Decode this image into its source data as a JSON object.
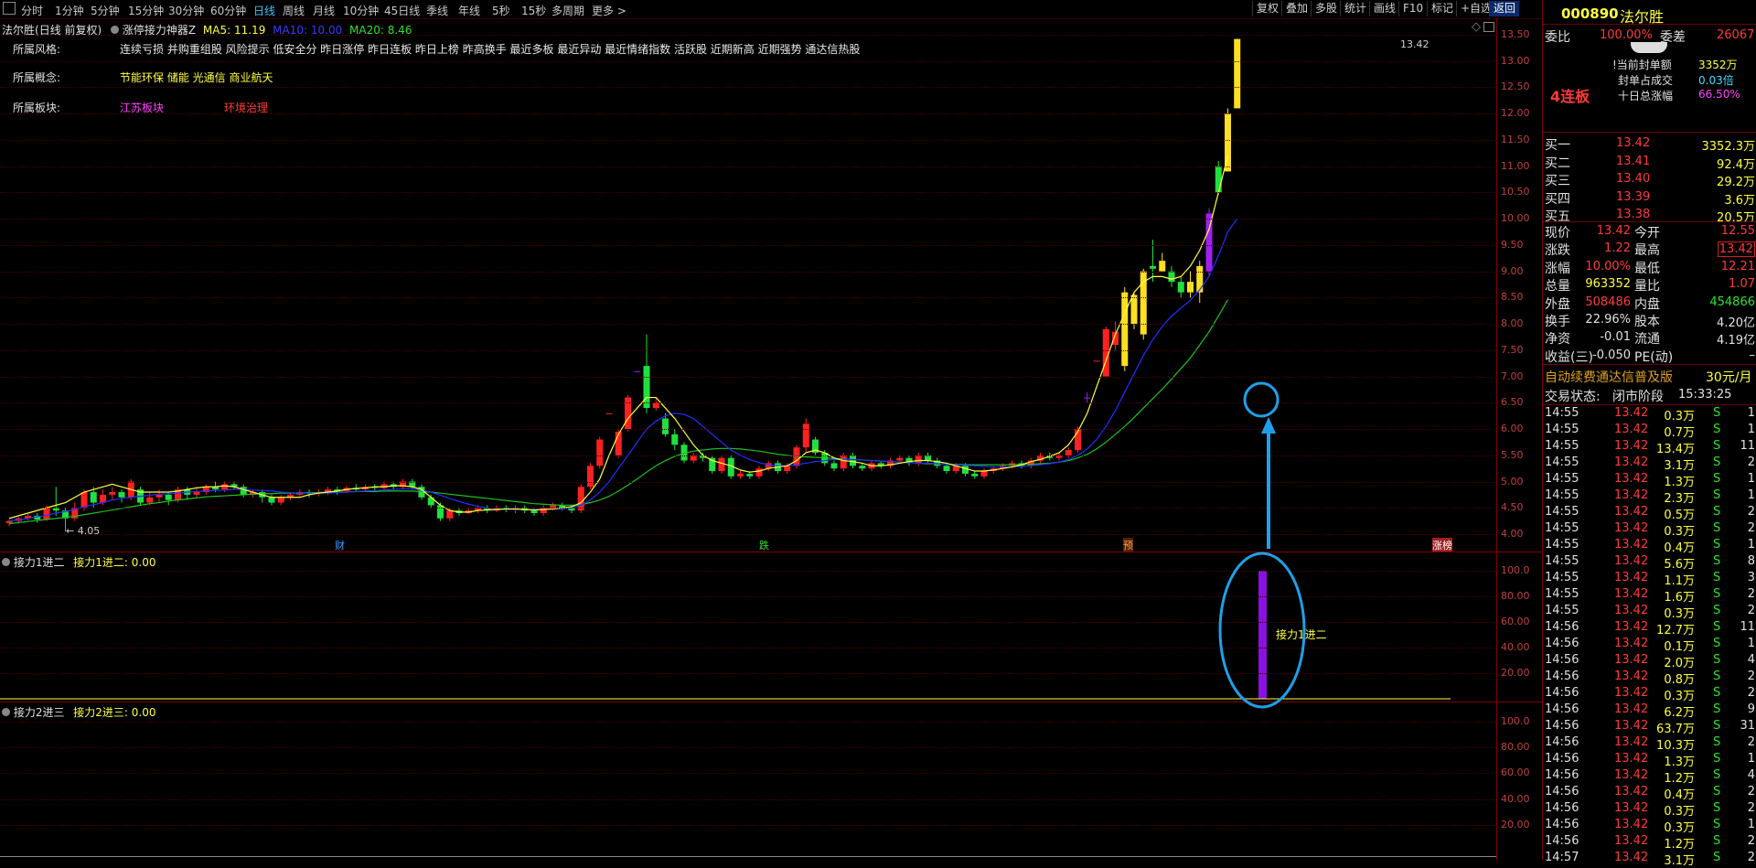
{
  "top_tabs": [
    "分时",
    "1分钟",
    "5分钟",
    "15分钟",
    "30分钟",
    "60分钟",
    "日线",
    "周线",
    "月线",
    "10分钟",
    "45日线",
    "季线",
    "年线",
    "5秒",
    "15秒",
    "多周期",
    "更多 >"
  ],
  "right_buttons": [
    "复权",
    "叠加",
    "多股",
    "统计",
    "画线",
    "F10",
    "标记",
    "+自选",
    "返回"
  ],
  "chart_header": {
    "stock": "法尔胜",
    "period": "(日线 前复权)",
    "indicator": "涨停接力神器Z",
    "ma5": "MA5: 11.19",
    "ma10": "MA10: 10.00",
    "ma20": "MA20: 8.46"
  },
  "info": {
    "style_label": "所属风格:",
    "style_value": "连续亏损 并购重组股 风险提示 低安全分 昨日涨停 昨日连板 昨日上榜 昨高换手 最近多板 最近异动 最近情绪指数 活跃股 近期新高 近期强势 通达信热股",
    "concept_label": "所属概念:",
    "concept_value": "节能环保 储能 光通信 商业航天",
    "sector_label": "所属板块:",
    "sector_1": "江苏板块",
    "sector_2": "环境治理"
  },
  "price_axis": [
    "13.50",
    "13.00",
    "12.50",
    "12.00",
    "11.50",
    "11.00",
    "10.50",
    "10.00",
    "9.50",
    "9.00",
    "8.50",
    "8.00",
    "7.50",
    "7.00",
    "6.50",
    "6.00",
    "5.50",
    "5.00",
    "4.50",
    "4.00"
  ],
  "chart_labels": {
    "high": "13.42",
    "low": "← 4.05",
    "event1": "财",
    "event2": "跌",
    "event3": "预",
    "event4": "涨榜"
  },
  "panel1": {
    "title": "接力1进二",
    "value": "接力1进二: 0.00",
    "signal": "接力1进二",
    "axis": [
      "100.0",
      "80.00",
      "60.00",
      "40.00",
      "20.00"
    ]
  },
  "panel2": {
    "title": "接力2进三",
    "value": "接力2进三: 0.00",
    "axis": [
      "100.0",
      "80.00",
      "60.00",
      "40.00",
      "20.00"
    ]
  },
  "chart_data": {
    "type": "candlestick",
    "ylim": [
      4.0,
      13.5
    ],
    "candles": [
      [
        4.21,
        4.25,
        4.15,
        4.28
      ],
      [
        4.25,
        4.3,
        4.2,
        4.33
      ],
      [
        4.3,
        4.35,
        4.26,
        4.38
      ],
      [
        4.35,
        4.28,
        4.22,
        4.4
      ],
      [
        4.28,
        4.5,
        4.25,
        4.55
      ],
      [
        4.5,
        4.45,
        4.35,
        4.9
      ],
      [
        4.45,
        4.3,
        4.05,
        4.5
      ],
      [
        4.3,
        4.5,
        4.25,
        4.6
      ],
      [
        4.5,
        4.8,
        4.45,
        4.85
      ],
      [
        4.8,
        4.6,
        4.5,
        4.9
      ],
      [
        4.6,
        4.75,
        4.55,
        4.85
      ],
      [
        4.75,
        4.8,
        4.65,
        4.9
      ],
      [
        4.8,
        4.7,
        4.6,
        4.85
      ],
      [
        4.7,
        5.0,
        4.65,
        5.05
      ],
      [
        4.85,
        4.6,
        4.55,
        4.9
      ],
      [
        4.6,
        4.7,
        4.55,
        4.8
      ],
      [
        4.7,
        4.75,
        4.6,
        4.85
      ],
      [
        4.75,
        4.65,
        4.55,
        4.8
      ],
      [
        4.65,
        4.85,
        4.6,
        4.9
      ],
      [
        4.85,
        4.75,
        4.65,
        4.9
      ],
      [
        4.75,
        4.8,
        4.7,
        4.9
      ],
      [
        4.8,
        4.9,
        4.75,
        4.95
      ],
      [
        4.9,
        4.85,
        4.8,
        5.0
      ],
      [
        4.85,
        4.95,
        4.8,
        5.0
      ],
      [
        4.95,
        4.9,
        4.85,
        5.0
      ],
      [
        4.9,
        4.75,
        4.7,
        4.95
      ],
      [
        4.75,
        4.8,
        4.7,
        4.85
      ],
      [
        4.8,
        4.7,
        4.6,
        4.85
      ],
      [
        4.7,
        4.6,
        4.55,
        4.75
      ],
      [
        4.6,
        4.7,
        4.55,
        4.75
      ],
      [
        4.7,
        4.75,
        4.65,
        4.8
      ],
      [
        4.75,
        4.8,
        4.7,
        4.85
      ],
      [
        4.8,
        4.78,
        4.7,
        4.85
      ],
      [
        4.78,
        4.8,
        4.72,
        4.85
      ],
      [
        4.8,
        4.85,
        4.75,
        4.9
      ],
      [
        4.85,
        4.82,
        4.75,
        4.9
      ],
      [
        4.82,
        4.88,
        4.78,
        4.92
      ],
      [
        4.88,
        4.85,
        4.8,
        4.95
      ],
      [
        4.85,
        4.9,
        4.8,
        4.95
      ],
      [
        4.9,
        4.88,
        4.82,
        4.95
      ],
      [
        4.88,
        4.95,
        4.85,
        5.0
      ],
      [
        4.95,
        4.9,
        4.85,
        5.0
      ],
      [
        4.9,
        5.0,
        4.85,
        5.05
      ],
      [
        5.0,
        4.9,
        4.85,
        5.05
      ],
      [
        4.9,
        4.7,
        4.65,
        4.95
      ],
      [
        4.7,
        4.55,
        4.5,
        4.75
      ],
      [
        4.55,
        4.3,
        4.25,
        4.6
      ],
      [
        4.3,
        4.45,
        4.25,
        4.5
      ],
      [
        4.45,
        4.4,
        4.35,
        4.5
      ],
      [
        4.4,
        4.45,
        4.38,
        4.5
      ],
      [
        4.45,
        4.5,
        4.4,
        4.55
      ],
      [
        4.5,
        4.45,
        4.4,
        4.55
      ],
      [
        4.45,
        4.5,
        4.42,
        4.55
      ],
      [
        4.5,
        4.48,
        4.42,
        4.55
      ],
      [
        4.48,
        4.5,
        4.4,
        4.55
      ],
      [
        4.5,
        4.45,
        4.4,
        4.55
      ],
      [
        4.45,
        4.4,
        4.35,
        4.5
      ],
      [
        4.4,
        4.5,
        4.35,
        4.55
      ],
      [
        4.5,
        4.55,
        4.45,
        4.6
      ],
      [
        4.55,
        4.5,
        4.45,
        4.6
      ],
      [
        4.5,
        4.45,
        4.4,
        4.55
      ],
      [
        4.45,
        4.9,
        4.4,
        4.95
      ],
      [
        4.9,
        5.3,
        4.85,
        5.35
      ],
      [
        5.3,
        5.8,
        5.25,
        5.85
      ],
      [
        6.3,
        6.3,
        6.3,
        6.3
      ],
      [
        5.5,
        5.95,
        5.45,
        6.0
      ],
      [
        6.0,
        6.6,
        5.95,
        6.65
      ],
      [
        7.1,
        7.1,
        7.1,
        7.1
      ],
      [
        7.2,
        6.4,
        6.3,
        7.8
      ],
      [
        6.4,
        6.5,
        6.35,
        6.6
      ],
      [
        6.2,
        5.9,
        5.85,
        6.3
      ],
      [
        5.9,
        5.7,
        5.6,
        6.0
      ],
      [
        5.7,
        5.4,
        5.35,
        5.75
      ],
      [
        5.4,
        5.5,
        5.35,
        5.55
      ],
      [
        5.5,
        5.45,
        5.38,
        5.55
      ],
      [
        5.45,
        5.2,
        5.15,
        5.5
      ],
      [
        5.2,
        5.45,
        5.15,
        5.5
      ],
      [
        5.45,
        5.1,
        5.05,
        5.5
      ],
      [
        5.1,
        5.15,
        5.05,
        5.2
      ],
      [
        5.15,
        5.1,
        5.05,
        5.2
      ],
      [
        5.1,
        5.25,
        5.05,
        5.3
      ],
      [
        5.25,
        5.35,
        5.2,
        5.4
      ],
      [
        5.35,
        5.2,
        5.15,
        5.4
      ],
      [
        5.2,
        5.3,
        5.15,
        5.35
      ],
      [
        5.3,
        5.65,
        5.25,
        5.7
      ],
      [
        5.65,
        6.1,
        5.55,
        6.2
      ],
      [
        5.8,
        5.55,
        5.5,
        5.85
      ],
      [
        5.55,
        5.35,
        5.3,
        5.6
      ],
      [
        5.35,
        5.25,
        5.2,
        5.4
      ],
      [
        5.25,
        5.5,
        5.2,
        5.55
      ],
      [
        5.5,
        5.3,
        5.25,
        5.55
      ],
      [
        5.3,
        5.25,
        5.2,
        5.35
      ],
      [
        5.25,
        5.35,
        5.2,
        5.4
      ],
      [
        5.35,
        5.3,
        5.25,
        5.4
      ],
      [
        5.3,
        5.4,
        5.25,
        5.45
      ],
      [
        5.4,
        5.45,
        5.35,
        5.5
      ],
      [
        5.45,
        5.35,
        5.3,
        5.5
      ],
      [
        5.35,
        5.5,
        5.3,
        5.55
      ],
      [
        5.5,
        5.4,
        5.35,
        5.55
      ],
      [
        5.4,
        5.3,
        5.25,
        5.45
      ],
      [
        5.3,
        5.2,
        5.15,
        5.35
      ],
      [
        5.2,
        5.3,
        5.15,
        5.35
      ],
      [
        5.3,
        5.15,
        5.1,
        5.35
      ],
      [
        5.15,
        5.1,
        5.05,
        5.2
      ],
      [
        5.1,
        5.2,
        5.05,
        5.25
      ],
      [
        5.2,
        5.25,
        5.15,
        5.3
      ],
      [
        5.25,
        5.3,
        5.2,
        5.35
      ],
      [
        5.3,
        5.35,
        5.25,
        5.4
      ],
      [
        5.35,
        5.3,
        5.25,
        5.4
      ],
      [
        5.3,
        5.4,
        5.25,
        5.45
      ],
      [
        5.4,
        5.5,
        5.35,
        5.55
      ],
      [
        5.5,
        5.45,
        5.4,
        5.55
      ],
      [
        5.45,
        5.5,
        5.4,
        5.55
      ],
      [
        5.5,
        5.6,
        5.45,
        5.65
      ],
      [
        5.6,
        6.0,
        5.55,
        6.05
      ],
      [
        6.6,
        6.6,
        6.5,
        6.7
      ],
      [
        7.3,
        7.3,
        7.3,
        7.3
      ],
      [
        7.0,
        7.9,
        7.0,
        7.95
      ],
      [
        7.6,
        7.85,
        7.5,
        8.05
      ],
      [
        7.2,
        8.6,
        7.1,
        8.7
      ],
      [
        8.0,
        8.55,
        7.9,
        8.6
      ],
      [
        7.8,
        9.0,
        7.7,
        9.05
      ],
      [
        9.1,
        9.05,
        8.8,
        9.6
      ],
      [
        9.0,
        9.2,
        9.0,
        9.35
      ],
      [
        9.0,
        8.8,
        8.7,
        9.1
      ],
      [
        8.8,
        8.6,
        8.5,
        8.9
      ],
      [
        8.6,
        8.8,
        8.5,
        9.0
      ],
      [
        8.6,
        9.1,
        8.4,
        9.2
      ],
      [
        9.0,
        10.1,
        8.9,
        10.2
      ],
      [
        11.0,
        10.5,
        10.45,
        11.1
      ],
      [
        10.9,
        12.0,
        10.9,
        12.1
      ],
      [
        12.1,
        13.42,
        12.1,
        13.42
      ]
    ],
    "ma5": [
      4.3,
      4.35,
      4.4,
      4.45,
      4.5,
      4.55,
      4.6,
      4.7,
      4.8,
      4.85,
      4.9,
      4.95,
      4.9,
      4.85,
      4.8,
      4.8,
      4.8,
      4.8,
      4.82,
      4.85,
      4.88,
      4.9,
      4.9,
      4.92,
      4.9,
      4.85,
      4.8,
      4.75,
      4.7,
      4.7,
      4.7,
      4.7,
      4.75,
      4.78,
      4.8,
      4.82,
      4.85,
      4.87,
      4.88,
      4.9,
      4.9,
      4.92,
      4.92,
      4.9,
      4.85,
      4.7,
      4.55,
      4.45,
      4.42,
      4.42,
      4.45,
      4.46,
      4.47,
      4.48,
      4.48,
      4.47,
      4.46,
      4.47,
      4.48,
      4.5,
      4.52,
      4.6,
      4.8,
      5.05,
      5.5,
      5.9,
      6.2,
      6.4,
      6.6,
      6.6,
      6.4,
      6.2,
      5.95,
      5.7,
      5.5,
      5.4,
      5.35,
      5.3,
      5.22,
      5.18,
      5.2,
      5.25,
      5.28,
      5.3,
      5.4,
      5.55,
      5.6,
      5.55,
      5.45,
      5.4,
      5.38,
      5.35,
      5.3,
      5.3,
      5.32,
      5.35,
      5.38,
      5.4,
      5.4,
      5.38,
      5.35,
      5.3,
      5.25,
      5.2,
      5.2,
      5.22,
      5.25,
      5.28,
      5.32,
      5.38,
      5.42,
      5.48,
      5.55,
      5.7,
      5.95,
      6.3,
      6.8,
      7.3,
      7.8,
      8.2,
      8.6,
      8.8,
      8.9,
      8.9,
      8.85,
      8.9,
      9.1,
      9.4,
      9.8,
      10.5,
      11.2
    ],
    "ma10": [
      4.25,
      4.27,
      4.3,
      4.33,
      4.36,
      4.4,
      4.43,
      4.47,
      4.52,
      4.56,
      4.6,
      4.65,
      4.68,
      4.7,
      4.72,
      4.74,
      4.76,
      4.77,
      4.78,
      4.8,
      4.81,
      4.82,
      4.83,
      4.84,
      4.85,
      4.85,
      4.84,
      4.83,
      4.82,
      4.8,
      4.79,
      4.78,
      4.78,
      4.78,
      4.78,
      4.79,
      4.8,
      4.81,
      4.82,
      4.83,
      4.84,
      4.85,
      4.86,
      4.86,
      4.84,
      4.8,
      4.74,
      4.68,
      4.62,
      4.57,
      4.53,
      4.5,
      4.48,
      4.47,
      4.47,
      4.47,
      4.47,
      4.47,
      4.48,
      4.48,
      4.5,
      4.55,
      4.65,
      4.8,
      5.0,
      5.25,
      5.5,
      5.75,
      6.0,
      6.15,
      6.25,
      6.3,
      6.28,
      6.2,
      6.05,
      5.9,
      5.75,
      5.6,
      5.5,
      5.42,
      5.36,
      5.32,
      5.3,
      5.3,
      5.32,
      5.35,
      5.38,
      5.4,
      5.42,
      5.42,
      5.42,
      5.41,
      5.4,
      5.39,
      5.38,
      5.37,
      5.36,
      5.35,
      5.35,
      5.34,
      5.33,
      5.32,
      5.31,
      5.3,
      5.29,
      5.28,
      5.28,
      5.28,
      5.29,
      5.3,
      5.32,
      5.34,
      5.37,
      5.42,
      5.5,
      5.62,
      5.8,
      6.05,
      6.35,
      6.7,
      7.05,
      7.4,
      7.7,
      7.95,
      8.15,
      8.3,
      8.45,
      8.65,
      8.9,
      9.3,
      9.75,
      10.0
    ],
    "ma20": [
      4.2,
      4.22,
      4.24,
      4.26,
      4.28,
      4.3,
      4.32,
      4.34,
      4.37,
      4.4,
      4.43,
      4.46,
      4.49,
      4.52,
      4.55,
      4.58,
      4.6,
      4.63,
      4.65,
      4.67,
      4.69,
      4.71,
      4.72,
      4.73,
      4.74,
      4.75,
      4.76,
      4.77,
      4.77,
      4.78,
      4.78,
      4.78,
      4.79,
      4.79,
      4.8,
      4.8,
      4.8,
      4.81,
      4.81,
      4.81,
      4.82,
      4.82,
      4.82,
      4.82,
      4.81,
      4.8,
      4.78,
      4.76,
      4.74,
      4.72,
      4.7,
      4.68,
      4.66,
      4.64,
      4.62,
      4.6,
      4.58,
      4.57,
      4.56,
      4.55,
      4.55,
      4.56,
      4.6,
      4.65,
      4.72,
      4.82,
      4.93,
      5.05,
      5.18,
      5.3,
      5.4,
      5.48,
      5.54,
      5.58,
      5.6,
      5.62,
      5.63,
      5.63,
      5.62,
      5.6,
      5.58,
      5.55,
      5.52,
      5.5,
      5.48,
      5.47,
      5.46,
      5.45,
      5.44,
      5.43,
      5.42,
      5.41,
      5.4,
      5.39,
      5.38,
      5.37,
      5.36,
      5.35,
      5.34,
      5.34,
      5.33,
      5.33,
      5.32,
      5.32,
      5.32,
      5.32,
      5.32,
      5.32,
      5.33,
      5.33,
      5.34,
      5.35,
      5.37,
      5.4,
      5.45,
      5.52,
      5.62,
      5.75,
      5.9,
      6.05,
      6.22,
      6.4,
      6.58,
      6.76,
      6.95,
      7.15,
      7.35,
      7.6,
      7.85,
      8.15,
      8.46
    ]
  },
  "sidebar": {
    "code": "000890",
    "name": "法尔胜",
    "weibi_label": "委比",
    "weibi_value": "100.00%",
    "weicha_label": "委差",
    "weicha_value": "26067",
    "streak": "4连板",
    "seal_label": "!当前封单额",
    "seal_value": "3352万",
    "seal_ratio_label": "封单占成交",
    "seal_ratio_value": "0.03倍",
    "tenday_label": "十日总涨幅",
    "tenday_value": "66.50%",
    "bids": [
      {
        "label": "买一",
        "price": "13.42",
        "vol": "3352.3万"
      },
      {
        "label": "买二",
        "price": "13.41",
        "vol": "92.4万"
      },
      {
        "label": "买三",
        "price": "13.40",
        "vol": "29.2万"
      },
      {
        "label": "买四",
        "price": "13.39",
        "vol": "3.6万"
      },
      {
        "label": "买五",
        "price": "13.38",
        "vol": "20.5万"
      }
    ],
    "stats": [
      {
        "l1": "现价",
        "v1": "13.42",
        "l2": "今开",
        "v2": "12.55"
      },
      {
        "l1": "涨跌",
        "v1": "1.22",
        "l2": "最高",
        "v2": "13.42"
      },
      {
        "l1": "涨幅",
        "v1": "10.00%",
        "l2": "最低",
        "v2": "12.21"
      },
      {
        "l1": "总量",
        "v1": "963352",
        "l2": "量比",
        "v2": "1.07"
      },
      {
        "l1": "外盘",
        "v1": "508486",
        "l2": "内盘",
        "v2": "454866"
      },
      {
        "l1": "换手",
        "v1": "22.96%",
        "l2": "股本",
        "v2": "4.20亿"
      },
      {
        "l1": "净资",
        "v1": "-0.01",
        "l2": "流通",
        "v2": "4.19亿"
      },
      {
        "l1": "收益(三)",
        "v1": "-0.050",
        "l2": "PE(动)",
        "v2": "–"
      }
    ],
    "ad": "自动续费通达信普及版",
    "ad_price": "30元/月",
    "status_label": "交易状态:",
    "status_value": "闭市阶段",
    "status_time": "15:33:25",
    "ticks": [
      [
        "14:55",
        "13.42",
        "0.3万",
        "S",
        "1"
      ],
      [
        "14:55",
        "13.42",
        "0.7万",
        "S",
        "1"
      ],
      [
        "14:55",
        "13.42",
        "13.4万",
        "S",
        "11"
      ],
      [
        "14:55",
        "13.42",
        "3.1万",
        "S",
        "2"
      ],
      [
        "14:55",
        "13.42",
        "1.3万",
        "S",
        "1"
      ],
      [
        "14:55",
        "13.42",
        "2.3万",
        "S",
        "1"
      ],
      [
        "14:55",
        "13.42",
        "0.5万",
        "S",
        "2"
      ],
      [
        "14:55",
        "13.42",
        "0.3万",
        "S",
        "2"
      ],
      [
        "14:55",
        "13.42",
        "0.4万",
        "S",
        "1"
      ],
      [
        "14:55",
        "13.42",
        "5.6万",
        "S",
        "8"
      ],
      [
        "14:55",
        "13.42",
        "1.1万",
        "S",
        "3"
      ],
      [
        "14:55",
        "13.42",
        "1.6万",
        "S",
        "2"
      ],
      [
        "14:55",
        "13.42",
        "0.3万",
        "S",
        "2"
      ],
      [
        "14:56",
        "13.42",
        "12.7万",
        "S",
        "11"
      ],
      [
        "14:56",
        "13.42",
        "0.1万",
        "S",
        "1"
      ],
      [
        "14:56",
        "13.42",
        "2.0万",
        "S",
        "4"
      ],
      [
        "14:56",
        "13.42",
        "0.8万",
        "S",
        "2"
      ],
      [
        "14:56",
        "13.42",
        "0.3万",
        "S",
        "2"
      ],
      [
        "14:56",
        "13.42",
        "6.2万",
        "S",
        "9"
      ],
      [
        "14:56",
        "13.42",
        "63.7万",
        "S",
        "31"
      ],
      [
        "14:56",
        "13.42",
        "10.3万",
        "S",
        "2"
      ],
      [
        "14:56",
        "13.42",
        "1.3万",
        "S",
        "1"
      ],
      [
        "14:56",
        "13.42",
        "1.2万",
        "S",
        "4"
      ],
      [
        "14:56",
        "13.42",
        "0.4万",
        "S",
        "2"
      ],
      [
        "14:56",
        "13.42",
        "0.3万",
        "S",
        "2"
      ],
      [
        "14:56",
        "13.42",
        "0.3万",
        "S",
        "1"
      ],
      [
        "14:56",
        "13.42",
        "1.2万",
        "S",
        "2"
      ],
      [
        "14:57",
        "13.42",
        "3.1万",
        "S",
        "2"
      ]
    ]
  }
}
